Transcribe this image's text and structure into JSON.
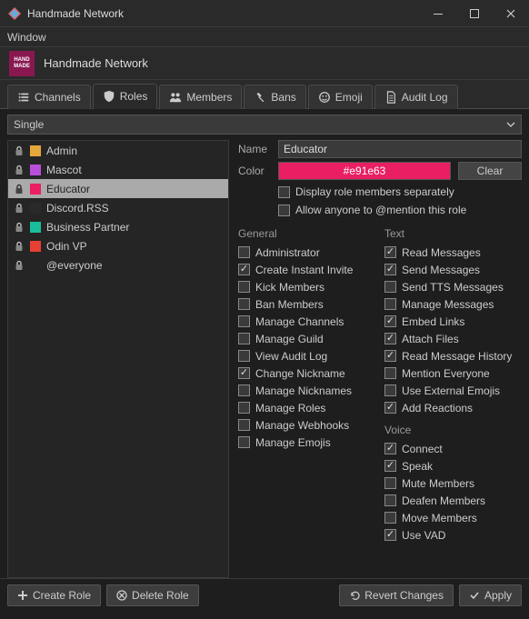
{
  "window": {
    "title": "Handmade Network"
  },
  "menubar": {
    "window": "Window"
  },
  "header": {
    "brand": "HAND MADE",
    "title": "Handmade Network"
  },
  "tabs": [
    {
      "label": "Channels"
    },
    {
      "label": "Roles"
    },
    {
      "label": "Members"
    },
    {
      "label": "Bans"
    },
    {
      "label": "Emoji"
    },
    {
      "label": "Audit Log"
    }
  ],
  "selector": {
    "value": "Single"
  },
  "roles": [
    {
      "name": "Admin",
      "color": "#e6a83a",
      "locked": true
    },
    {
      "name": "Mascot",
      "color": "#b94edb",
      "locked": true
    },
    {
      "name": "Educator",
      "color": "#e91e63",
      "locked": true,
      "selected": true
    },
    {
      "name": "Discord.RSS",
      "color": "#2a2a2a",
      "locked": true
    },
    {
      "name": "Business Partner",
      "color": "#19bd9c",
      "locked": true
    },
    {
      "name": "Odin VP",
      "color": "#e63f34",
      "locked": true
    },
    {
      "name": "@everyone",
      "color": "",
      "locked": true
    }
  ],
  "form": {
    "name_label": "Name",
    "name_value": "Educator",
    "color_label": "Color",
    "color_value": "#e91e63",
    "clear": "Clear",
    "display_separately": "Display role members separately",
    "allow_mention": "Allow anyone to @mention this role"
  },
  "perms": {
    "general": {
      "title": "General",
      "items": [
        {
          "label": "Administrator",
          "on": false
        },
        {
          "label": "Create Instant Invite",
          "on": true
        },
        {
          "label": "Kick Members",
          "on": false
        },
        {
          "label": "Ban Members",
          "on": false
        },
        {
          "label": "Manage Channels",
          "on": false
        },
        {
          "label": "Manage Guild",
          "on": false
        },
        {
          "label": "View Audit Log",
          "on": false
        },
        {
          "label": "Change Nickname",
          "on": true
        },
        {
          "label": "Manage Nicknames",
          "on": false
        },
        {
          "label": "Manage Roles",
          "on": false
        },
        {
          "label": "Manage Webhooks",
          "on": false
        },
        {
          "label": "Manage Emojis",
          "on": false
        }
      ]
    },
    "text": {
      "title": "Text",
      "items": [
        {
          "label": "Read Messages",
          "on": true
        },
        {
          "label": "Send Messages",
          "on": true
        },
        {
          "label": "Send TTS Messages",
          "on": false
        },
        {
          "label": "Manage Messages",
          "on": false
        },
        {
          "label": "Embed Links",
          "on": true
        },
        {
          "label": "Attach Files",
          "on": true
        },
        {
          "label": "Read Message History",
          "on": true
        },
        {
          "label": "Mention Everyone",
          "on": false
        },
        {
          "label": "Use External Emojis",
          "on": false
        },
        {
          "label": "Add Reactions",
          "on": true
        }
      ]
    },
    "voice": {
      "title": "Voice",
      "items": [
        {
          "label": "Connect",
          "on": true
        },
        {
          "label": "Speak",
          "on": true
        },
        {
          "label": "Mute Members",
          "on": false
        },
        {
          "label": "Deafen Members",
          "on": false
        },
        {
          "label": "Move Members",
          "on": false
        },
        {
          "label": "Use VAD",
          "on": true
        }
      ]
    }
  },
  "footer": {
    "create": "Create Role",
    "delete": "Delete Role",
    "revert": "Revert Changes",
    "apply": "Apply"
  }
}
